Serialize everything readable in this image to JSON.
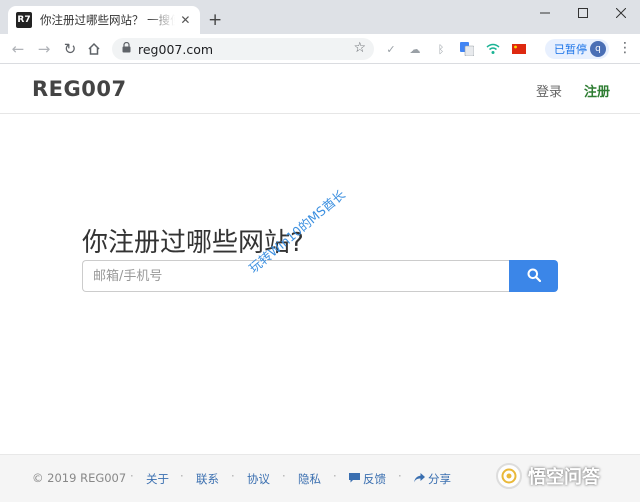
{
  "browser": {
    "favicon_text": "R7",
    "tab_title": "你注册过哪些网站？ 一搜便知 - R",
    "url": "reg007.com",
    "profile_label": "已暂停",
    "avatar_initial": "q",
    "icons": {
      "tab_close": "close-icon",
      "new_tab": "plus-icon",
      "minimize": "minimize-icon",
      "maximize": "maximize-icon",
      "close_window": "close-icon",
      "back": "arrow-left-icon",
      "forward": "arrow-right-icon",
      "reload": "reload-icon",
      "home": "home-icon",
      "lock": "lock-icon",
      "bookmark": "star-icon",
      "menu": "kebab-menu-icon"
    },
    "extensions": [
      "check-icon",
      "cloud-icon",
      "bluetooth-icon",
      "translate-icon",
      "wifi-icon",
      "flag-icon"
    ]
  },
  "site": {
    "brand": "REG007",
    "nav": {
      "login": "登录",
      "register": "注册"
    },
    "hero_title": "你注册过哪些网站?",
    "search": {
      "placeholder": "邮箱/手机号",
      "value": ""
    },
    "watermark": "玩转Win10的MS酋长",
    "colors": {
      "accent": "#3b86e8",
      "register": "#2e7d32",
      "link": "#3a6fb0"
    }
  },
  "footer": {
    "copyright": "© 2019 REG007",
    "links": {
      "about": "关于",
      "contact": "联系",
      "terms": "协议",
      "privacy": "隐私",
      "feedback": "反馈",
      "share": "分享"
    },
    "corner_watermark": "悟空问答"
  }
}
